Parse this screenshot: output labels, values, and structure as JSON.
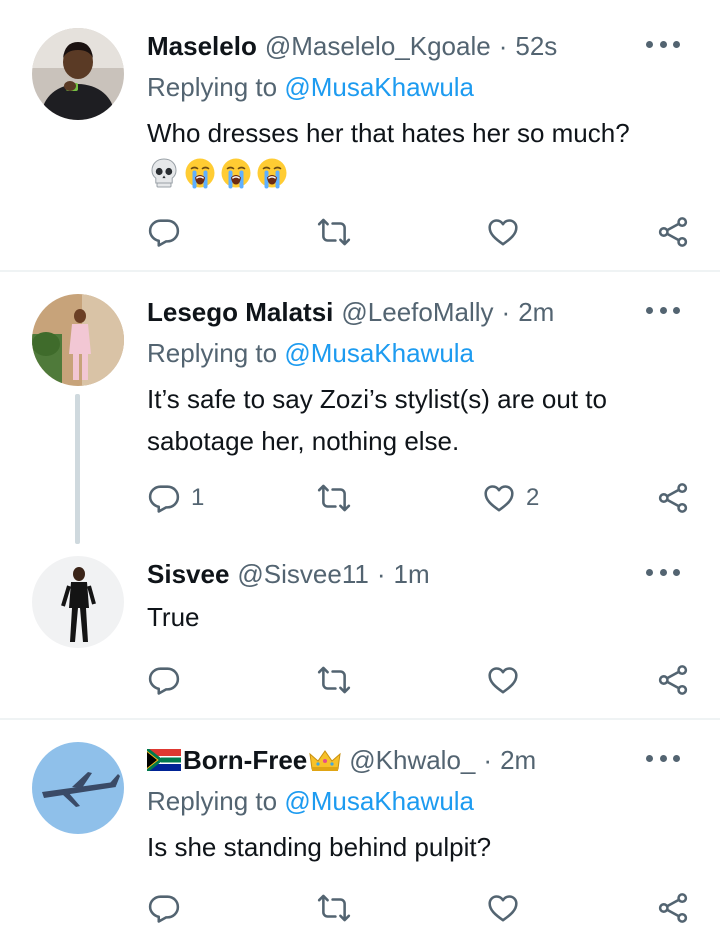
{
  "tweets": [
    {
      "name": "Maselelo",
      "handle": "@Maselelo_Kgoale",
      "separator": "·",
      "time": "52s",
      "replying_prefix": "Replying to",
      "replying_mention": "@MusaKhawula",
      "text": "Who dresses her that hates her so much?",
      "emojis": [
        "skull",
        "loudly-crying-face",
        "loudly-crying-face",
        "loudly-crying-face"
      ],
      "reply_count": "",
      "retweet_count": "",
      "like_count": ""
    },
    {
      "name": "Lesego Malatsi",
      "handle": "@LeefoMally",
      "separator": "·",
      "time": "2m",
      "replying_prefix": "Replying to",
      "replying_mention": "@MusaKhawula",
      "text": "It’s safe to say Zozi’s stylist(s) are out to sabotage her, nothing else.",
      "reply_count": "1",
      "retweet_count": "",
      "like_count": "2"
    },
    {
      "name": "Sisvee",
      "handle": "@Sisvee11",
      "separator": "·",
      "time": "1m",
      "text": "True",
      "reply_count": "",
      "retweet_count": "",
      "like_count": ""
    },
    {
      "name": "Born-Free",
      "name_decorations": [
        "south-africa-flag",
        "crown"
      ],
      "handle": "@Khwalo_",
      "separator": "·",
      "time": "2m",
      "replying_prefix": "Replying to",
      "replying_mention": "@MusaKhawula",
      "text": "Is she standing behind pulpit?",
      "reply_count": "",
      "retweet_count": "",
      "like_count": ""
    }
  ],
  "icons": {
    "reply": "reply-icon",
    "retweet": "retweet-icon",
    "like": "like-icon",
    "share": "share-icon",
    "more": "more-icon"
  },
  "colors": {
    "text": "#0f1419",
    "secondary": "#536471",
    "accent": "#1d9bf0",
    "divider": "#eff3f4",
    "thread_line": "#cfd9de"
  }
}
